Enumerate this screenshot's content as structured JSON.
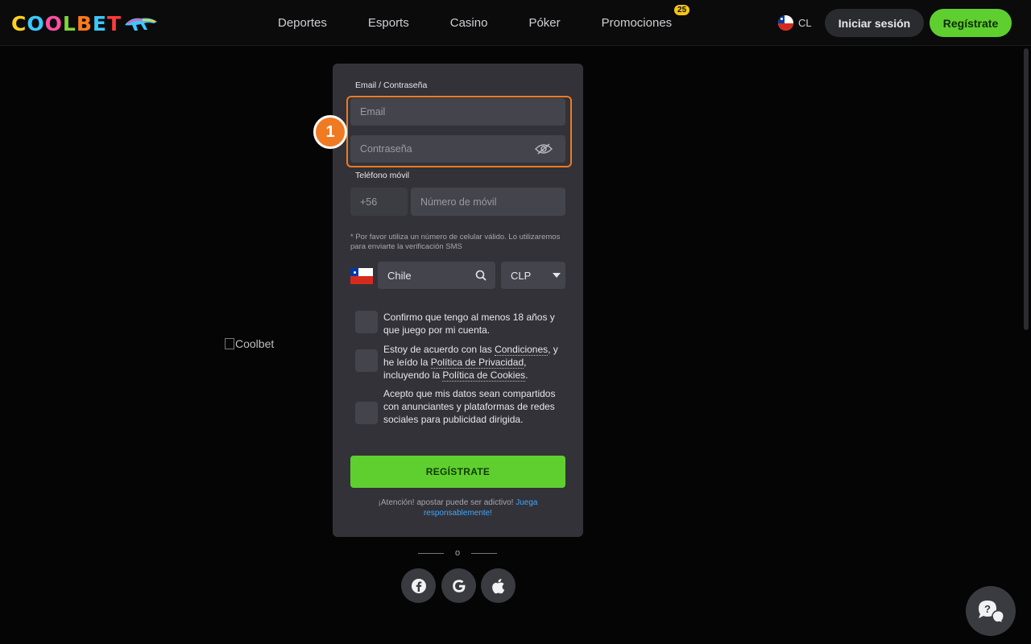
{
  "header": {
    "logo_text": "COOLBET",
    "nav": [
      {
        "label": "Deportes"
      },
      {
        "label": "Esports"
      },
      {
        "label": "Casino"
      },
      {
        "label": "Póker"
      },
      {
        "label": "Promociones",
        "badge": "25"
      }
    ],
    "country_code": "CL",
    "login_label": "Iniciar sesión",
    "register_label": "Regístrate"
  },
  "broken_image_alt": "Coolbet",
  "form": {
    "credentials_label": "Email / Contraseña",
    "email_placeholder": "Email",
    "password_placeholder": "Contraseña",
    "phone_label": "Teléfono móvil",
    "phone_prefix": "+56",
    "phone_placeholder": "Número de móvil",
    "phone_hint": "* Por favor utiliza un número de celular válido. Lo utilizaremos para enviarte la verificación SMS",
    "country_value": "Chile",
    "currency_value": "CLP",
    "checkboxes": {
      "age": "Confirmo que tengo al menos 18 años y que juego por mi cuenta.",
      "terms_prefix": "Estoy de acuerdo con las ",
      "terms_link": "Condiciones",
      "terms_mid": ", y he leído la ",
      "privacy_link": "Política de Privacidad",
      "terms_mid2": ", incluyendo la ",
      "cookies_link": "Política de Cookies",
      "terms_suffix": ".",
      "marketing": "Acepto que mis datos sean compartidos con anunciantes y plataformas de redes sociales para publicidad dirigida."
    },
    "submit_label": "REGÍSTRATE",
    "warning_text": "¡Atención! apostar puede ser adictivo! ",
    "warning_link": "Juega responsablemente!"
  },
  "divider_text": "o",
  "annotation_number": "1",
  "colors": {
    "accent_green": "#5fcf2f",
    "highlight_orange": "#f07a22",
    "link_blue": "#3ea6ff"
  },
  "icons": [
    "eye-off-icon",
    "search-icon",
    "caret-down-icon",
    "facebook-icon",
    "google-icon",
    "apple-icon",
    "chat-help-icon"
  ]
}
